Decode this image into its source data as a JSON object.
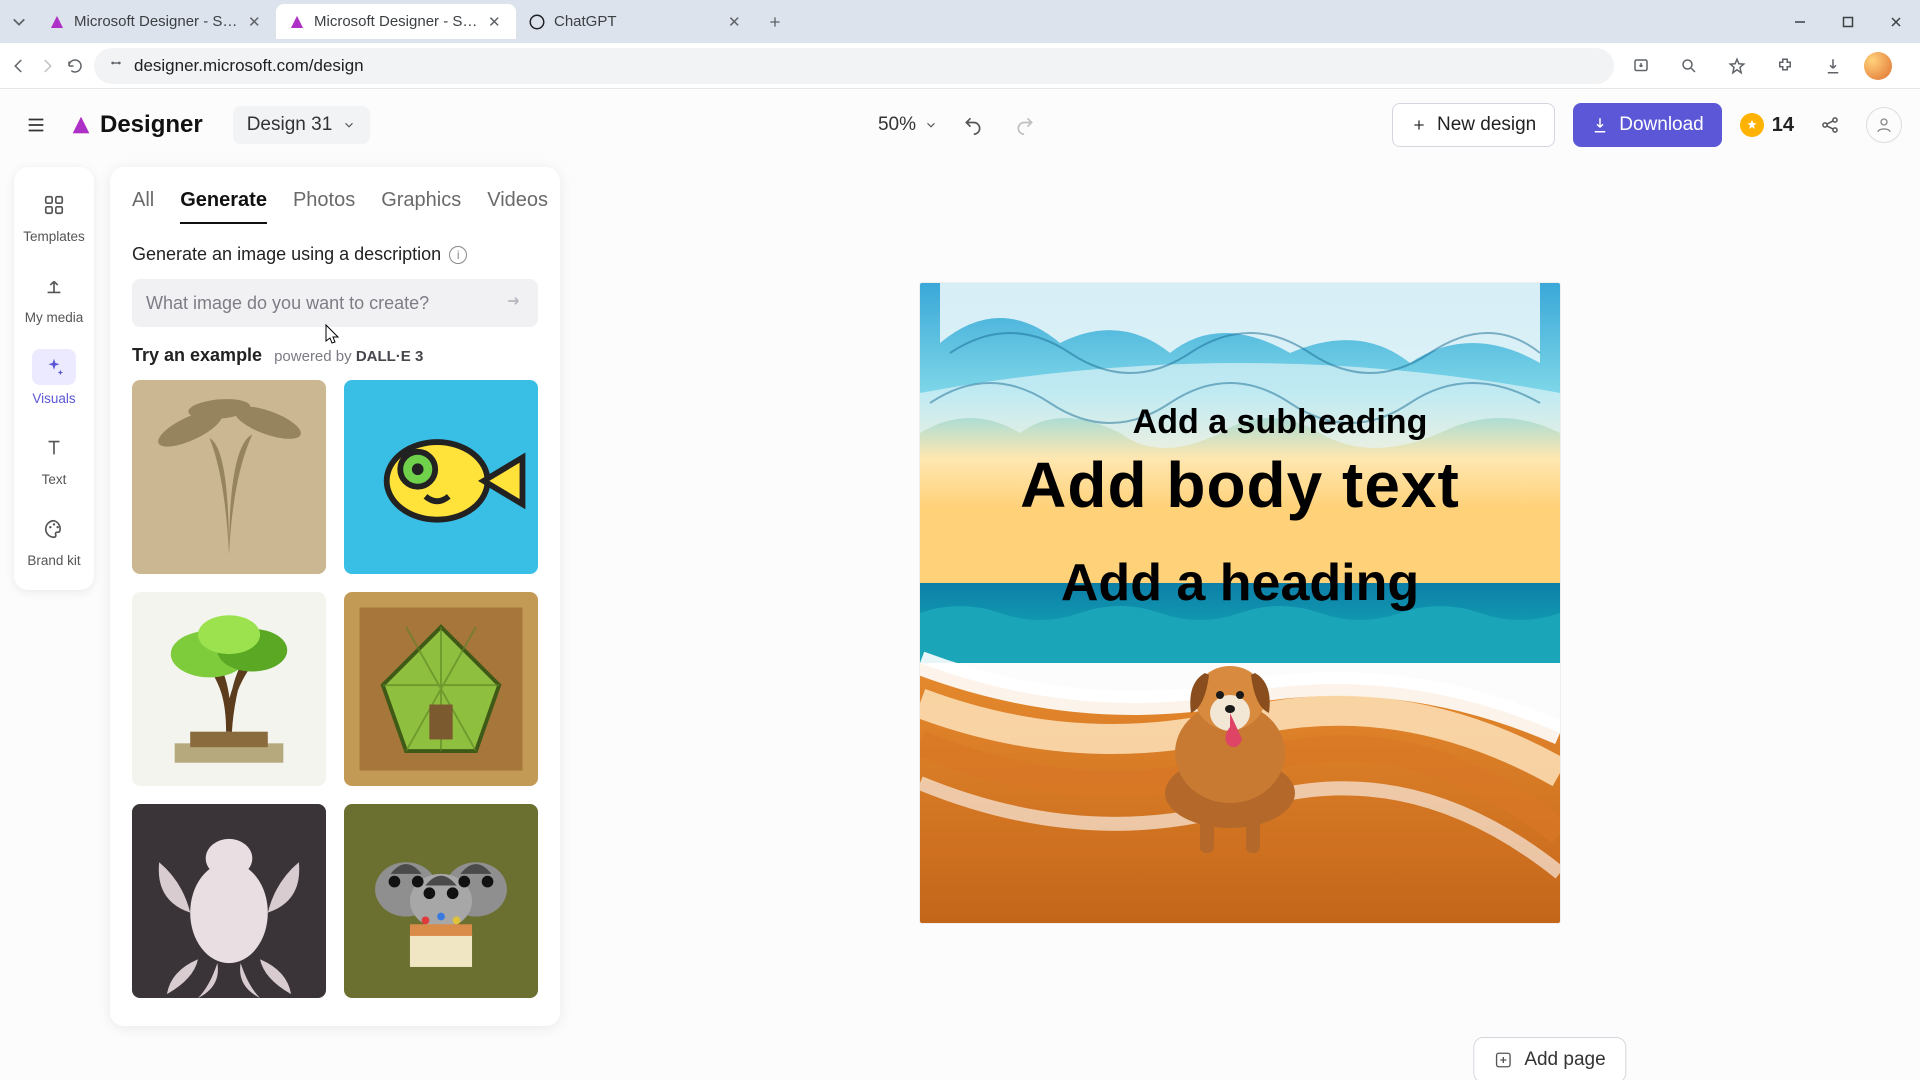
{
  "browser": {
    "tabs": [
      {
        "title": "Microsoft Designer - Stunning",
        "active": false
      },
      {
        "title": "Microsoft Designer - Stunning",
        "active": true
      },
      {
        "title": "ChatGPT",
        "active": false
      }
    ],
    "url": "designer.microsoft.com/design"
  },
  "header": {
    "brand": "Designer",
    "design_name": "Design 31",
    "zoom": "50%",
    "new_design": "New design",
    "download": "Download",
    "credits": "14"
  },
  "colors": {
    "primary": "#5b57d6"
  },
  "rail": {
    "items": [
      {
        "label": "Templates",
        "icon": "templates-icon"
      },
      {
        "label": "My media",
        "icon": "upload-icon"
      },
      {
        "label": "Visuals",
        "icon": "sparkle-icon",
        "active": true
      },
      {
        "label": "Text",
        "icon": "text-icon"
      },
      {
        "label": "Brand kit",
        "icon": "palette-icon"
      }
    ]
  },
  "panel": {
    "tabs": [
      "All",
      "Generate",
      "Photos",
      "Graphics",
      "Videos"
    ],
    "active_tab": "Generate",
    "subtitle": "Generate an image using a description",
    "placeholder": "What image do you want to create?",
    "example_label": "Try an example",
    "powered": "powered by",
    "dalle": "DALL·E 3"
  },
  "canvas": {
    "subheading": "Add a subheading",
    "body": "Add body text",
    "heading": "Add a heading"
  },
  "add_page": "Add page"
}
